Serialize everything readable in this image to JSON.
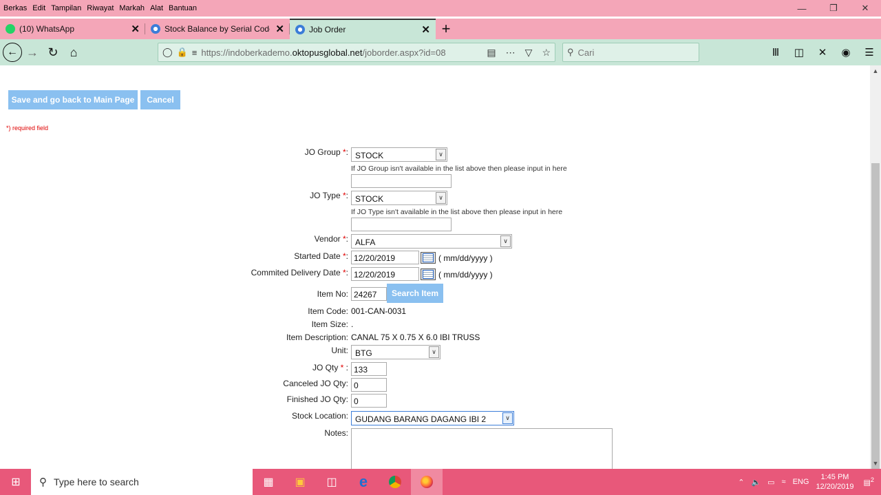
{
  "menubar": {
    "items": [
      "Berkas",
      "Edit",
      "Tampilan",
      "Riwayat",
      "Markah",
      "Alat",
      "Bantuan"
    ]
  },
  "tabs": [
    {
      "label": "(10) WhatsApp",
      "active": false
    },
    {
      "label": "Stock Balance by Serial Code",
      "active": false
    },
    {
      "label": "Job Order",
      "active": true
    }
  ],
  "address": {
    "url_prefix": "https://indoberkademo.",
    "url_domain": "oktopusglobal.net",
    "url_path": "/joborder.aspx?id=08"
  },
  "search": {
    "placeholder": "Cari"
  },
  "buttons": {
    "save": "Save and go back to Main Page",
    "cancel": "Cancel",
    "search_item": "Search Item"
  },
  "required_note": "*) required field",
  "form": {
    "jo_group": {
      "label": "JO Group ",
      "star": "*",
      "colon": ":",
      "value": "STOCK",
      "hint": "If JO Group isn't available in the list above then please input in here"
    },
    "jo_type": {
      "label": "JO Type ",
      "star": "*",
      "colon": ":",
      "value": "STOCK",
      "hint": "If JO Type isn't available in the list above then please input in here"
    },
    "vendor": {
      "label": "Vendor ",
      "star": "*",
      "colon": ":",
      "value": "ALFA"
    },
    "started_date": {
      "label": "Started Date ",
      "star": "*",
      "colon": ":",
      "value": "12/20/2019",
      "format": "( mm/dd/yyyy )"
    },
    "delivery_date": {
      "label": "Commited Delivery Date ",
      "star": "*",
      "colon": ":",
      "value": "12/20/2019",
      "format": "( mm/dd/yyyy )"
    },
    "item_no": {
      "label": "Item No:",
      "value": "24267"
    },
    "item_code": {
      "label": "Item Code:",
      "value": "001-CAN-0031"
    },
    "item_size": {
      "label": "Item Size:",
      "value": "."
    },
    "item_description": {
      "label": "Item Description:",
      "value": "CANAL 75 X 0.75 X 6.0 IBI TRUSS"
    },
    "unit": {
      "label": "Unit:",
      "value": "BTG"
    },
    "jo_qty": {
      "label": "JO Qty ",
      "star": "*",
      "colon": " :",
      "value": "133"
    },
    "canceled_qty": {
      "label": "Canceled JO Qty:",
      "value": "0"
    },
    "finished_qty": {
      "label": "Finished JO Qty:",
      "value": "0"
    },
    "stock_location": {
      "label": "Stock Location:",
      "value": "GUDANG BARANG DAGANG IBI 2"
    },
    "notes": {
      "label": "Notes:",
      "value": ""
    }
  },
  "taskbar": {
    "search_placeholder": "Type here to search",
    "time": "1:45 PM",
    "date": "12/20/2019",
    "lang": "ENG",
    "notif_count": "2"
  },
  "colors": {
    "menubar": "#f4a6b8",
    "navbar": "#c8e6d7",
    "button": "#8ac0f0",
    "required": "#e00000",
    "taskbar": "#e8587a"
  }
}
